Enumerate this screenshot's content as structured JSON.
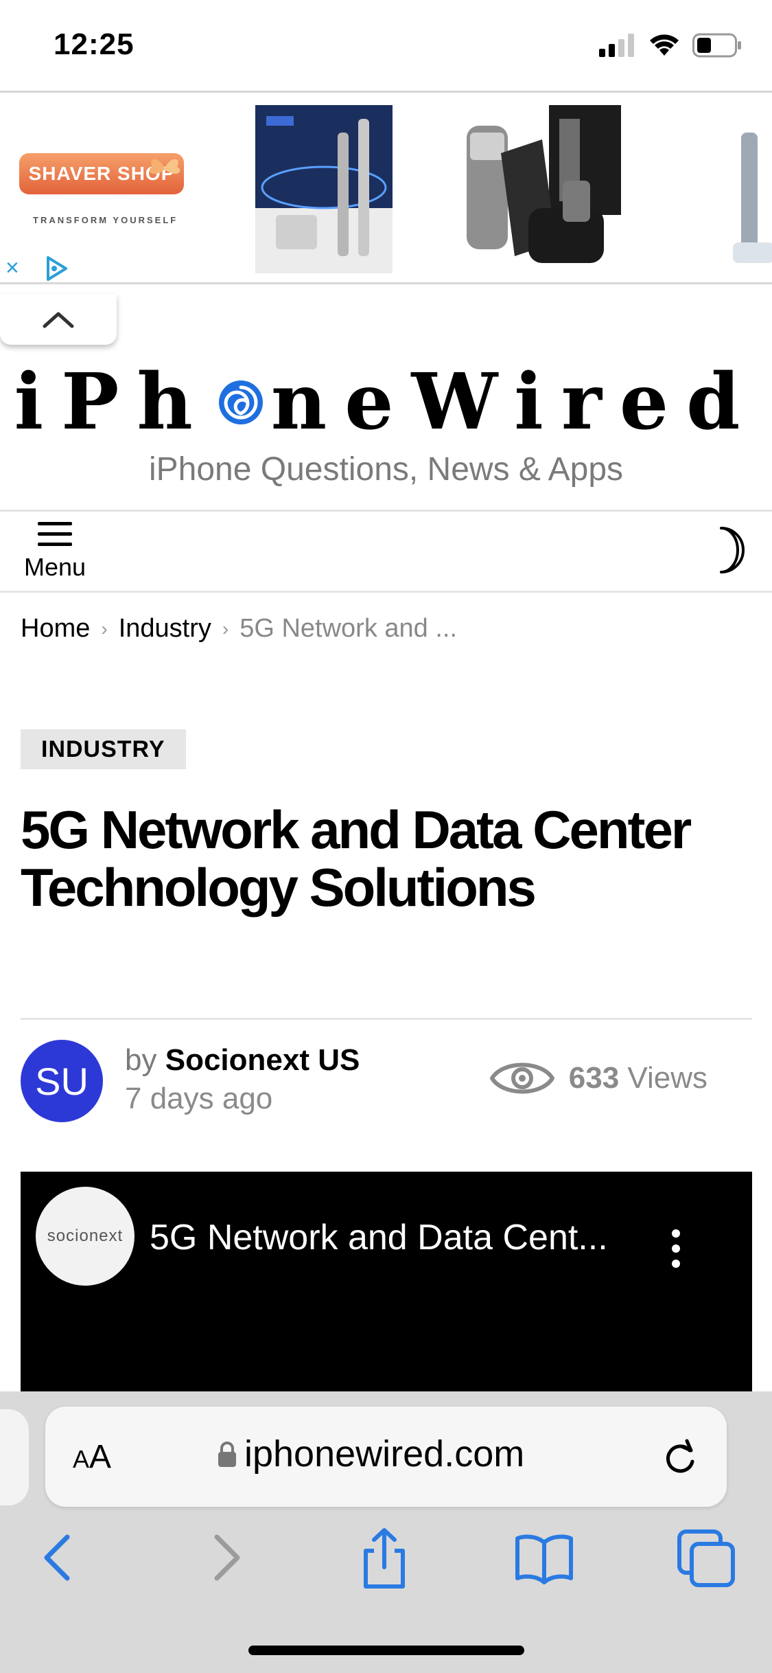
{
  "status_bar": {
    "time": "12:25",
    "icons": [
      "cellular-signal-icon",
      "wifi-icon",
      "battery-icon"
    ]
  },
  "ad": {
    "brand": "SHAVER SHOP",
    "tagline": "TRANSFORM YOURSELF",
    "close_icon": "close-icon",
    "adchoices_icon": "adchoices-icon",
    "products": [
      "oral-b-toothbrush-set",
      "braun-shaver-box",
      "braun-shaver",
      "electric-toothbrush"
    ]
  },
  "site": {
    "logo_title_left": "iPh",
    "logo_title_right": "neWired",
    "tagline": "iPhone Questions, News & Apps"
  },
  "nav": {
    "menu_label": "Menu",
    "theme_icon": "moon-icon"
  },
  "breadcrumb": {
    "home": "Home",
    "category": "Industry",
    "current": "5G Network and ..."
  },
  "article": {
    "category": "INDUSTRY",
    "title": "5G Network and Data Center Technology Solutions",
    "author_initials": "SU",
    "author_by": "by",
    "author_name": "Socionext US",
    "date": "7 days ago",
    "views_count": "633",
    "views_label": "Views"
  },
  "video": {
    "channel_logo_text": "socionext",
    "title": "5G Network and Data Cent..."
  },
  "safari": {
    "aa_label_small": "A",
    "aa_label_large": "A",
    "url": "iphonewired.com",
    "toolbar_icons": [
      "back-icon",
      "forward-icon",
      "share-icon",
      "bookmarks-icon",
      "tabs-icon"
    ]
  },
  "colors": {
    "accent_blue": "#2a7ae2",
    "avatar_blue": "#2d39d6",
    "logo_o_blue": "#1f6fe0"
  }
}
